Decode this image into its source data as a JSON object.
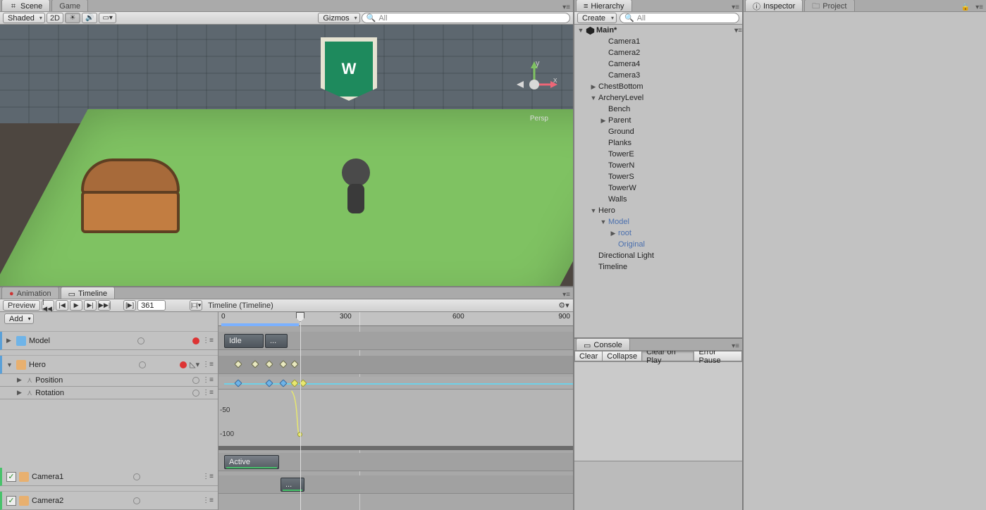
{
  "scene": {
    "tabs": {
      "scene": "Scene",
      "game": "Game"
    },
    "toolbar": {
      "shading": "Shaded",
      "mode2d": "2D",
      "gizmos": "Gizmos",
      "search_placeholder": "All"
    },
    "persp_label": "Persp",
    "axes": {
      "x": "x",
      "y": "y"
    }
  },
  "lower": {
    "tabs": {
      "animation": "Animation",
      "timeline": "Timeline"
    },
    "preview": "Preview",
    "frame": "361",
    "timeline_label": "Timeline (Timeline)",
    "add": "Add",
    "ruler_ticks": [
      "0",
      "300",
      "600"
    ],
    "ruler_end": "900",
    "tracks": {
      "model": "Model",
      "hero": "Hero",
      "position": "Position",
      "rotation": "Rotation",
      "camera1": "Camera1",
      "camera2": "Camera2"
    },
    "clips": {
      "idle": "Idle",
      "menu": "...",
      "active": "Active",
      "dots": "..."
    },
    "curve_labels": {
      "neg50": "-50",
      "neg100": "-100"
    }
  },
  "hierarchy": {
    "tab": "Hierarchy",
    "create": "Create",
    "search_placeholder": "All",
    "scene_name": "Main*",
    "items": [
      {
        "label": "Camera1",
        "indent": 2,
        "link": false
      },
      {
        "label": "Camera2",
        "indent": 2,
        "link": false
      },
      {
        "label": "Camera4",
        "indent": 2,
        "link": false
      },
      {
        "label": "Camera3",
        "indent": 2,
        "link": false
      },
      {
        "label": "ChestBottom",
        "indent": 1,
        "fold": "▶",
        "link": false
      },
      {
        "label": "ArcheryLevel",
        "indent": 1,
        "fold": "▼",
        "link": false
      },
      {
        "label": "Bench",
        "indent": 2,
        "link": false
      },
      {
        "label": "Parent",
        "indent": 2,
        "fold": "▶",
        "link": false
      },
      {
        "label": "Ground",
        "indent": 2,
        "link": false
      },
      {
        "label": "Planks",
        "indent": 2,
        "link": false
      },
      {
        "label": "TowerE",
        "indent": 2,
        "link": false
      },
      {
        "label": "TowerN",
        "indent": 2,
        "link": false
      },
      {
        "label": "TowerS",
        "indent": 2,
        "link": false
      },
      {
        "label": "TowerW",
        "indent": 2,
        "link": false
      },
      {
        "label": "Walls",
        "indent": 2,
        "link": false
      },
      {
        "label": "Hero",
        "indent": 1,
        "fold": "▼",
        "link": false
      },
      {
        "label": "Model",
        "indent": 2,
        "fold": "▼",
        "link": true
      },
      {
        "label": "root",
        "indent": 3,
        "fold": "▶",
        "link": true
      },
      {
        "label": "Original",
        "indent": 3,
        "link": true
      },
      {
        "label": "Directional Light",
        "indent": 1,
        "link": false
      },
      {
        "label": "Timeline",
        "indent": 1,
        "link": false
      }
    ]
  },
  "console": {
    "tab": "Console",
    "buttons": {
      "clear": "Clear",
      "collapse": "Collapse",
      "clear_on_play": "Clear on Play",
      "error_pause": "Error Pause"
    }
  },
  "inspector": {
    "tab": "Inspector",
    "project_tab": "Project"
  }
}
